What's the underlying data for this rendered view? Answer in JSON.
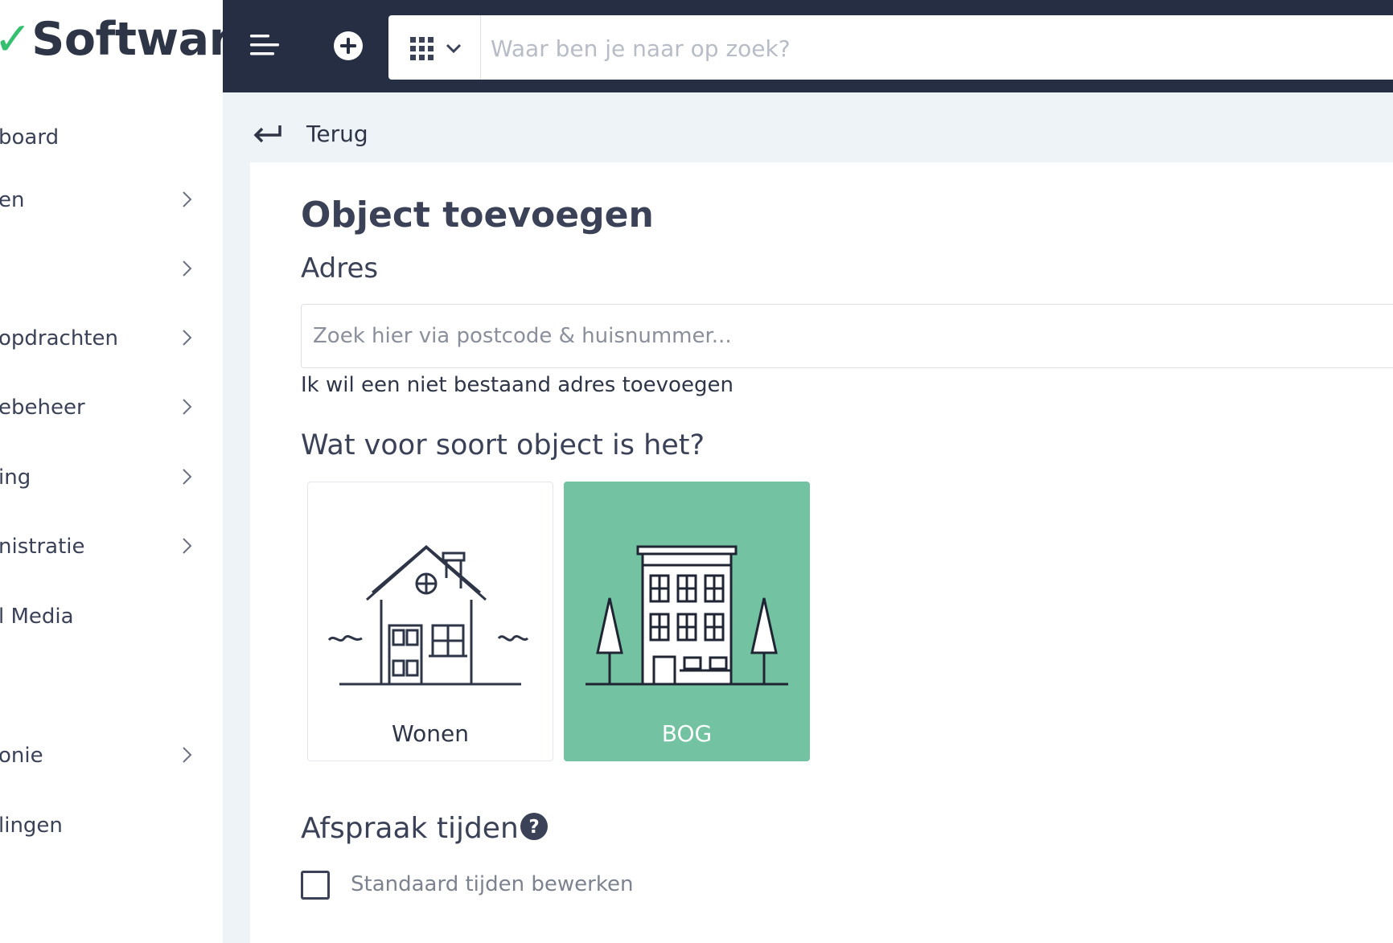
{
  "app": {
    "logo_text": "Software",
    "brand_color": "#34c06e"
  },
  "sidebar": {
    "items": [
      {
        "label": "board",
        "has_chevron": false
      },
      {
        "label": "en",
        "has_chevron": true
      },
      {
        "label": "",
        "has_chevron": true
      },
      {
        "label": "opdrachten",
        "has_chevron": true
      },
      {
        "label": "ebeheer",
        "has_chevron": true
      },
      {
        "label": "ing",
        "has_chevron": true
      },
      {
        "label": "nistratie",
        "has_chevron": true
      },
      {
        "label": "l Media",
        "has_chevron": false
      },
      {
        "label": "onie",
        "has_chevron": true
      },
      {
        "label": "lingen",
        "has_chevron": false
      }
    ]
  },
  "topbar": {
    "background": "#252e42",
    "menu_icon": "menu-icon",
    "add_icon": "plus-circle-icon",
    "apps_icon": "grid-icon",
    "search_placeholder": "Waar ben je naar op zoek?"
  },
  "back": {
    "label": "Terug",
    "icon": "back-arrow-icon"
  },
  "form": {
    "title": "Object toevoegen",
    "address_label": "Adres",
    "address_placeholder": "Zoek hier via postcode & huisnummer...",
    "no_address_link": "Ik wil een niet bestaand adres toevoegen",
    "object_type_heading": "Wat voor soort object is het?",
    "object_types": [
      {
        "label": "Wonen",
        "icon": "house-icon",
        "selected": false
      },
      {
        "label": "BOG",
        "icon": "building-icon",
        "selected": true
      }
    ],
    "selected_color": "#73c2a1",
    "appointment_heading": "Afspraak tijden",
    "help_icon": "help-icon",
    "default_times_label": "Standaard tijden bewerken",
    "default_times_checked": false
  }
}
